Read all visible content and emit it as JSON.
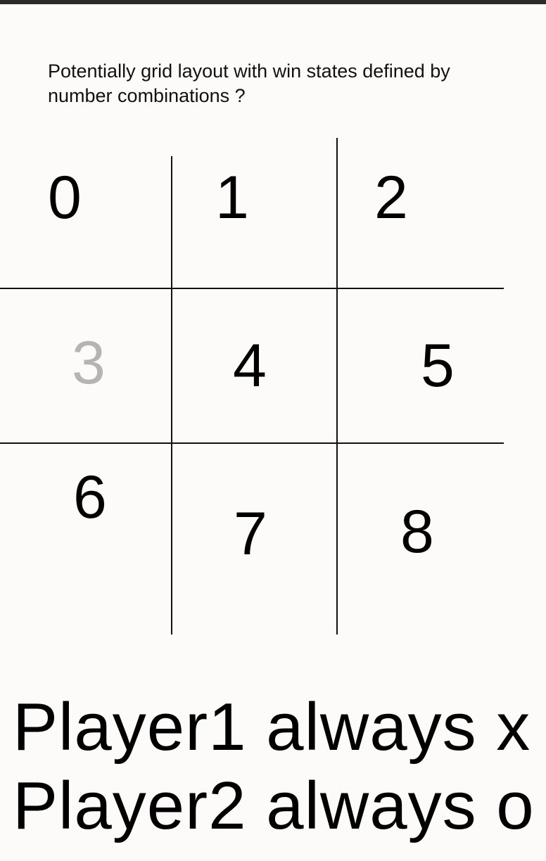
{
  "note": {
    "line1": "Potentially grid layout with win states defined by",
    "line2": "number combinations ?"
  },
  "grid": {
    "cells": [
      "0",
      "1",
      "2",
      "3",
      "4",
      "5",
      "6",
      "7",
      "8"
    ]
  },
  "footer": {
    "line1": "Player1 always x",
    "line2": "Player2 always o"
  },
  "colors": {
    "background": "#fcfbf9",
    "ink": "#000000",
    "faded_digit": "#b4b4b4",
    "top_bar": "#2b2b2b"
  }
}
